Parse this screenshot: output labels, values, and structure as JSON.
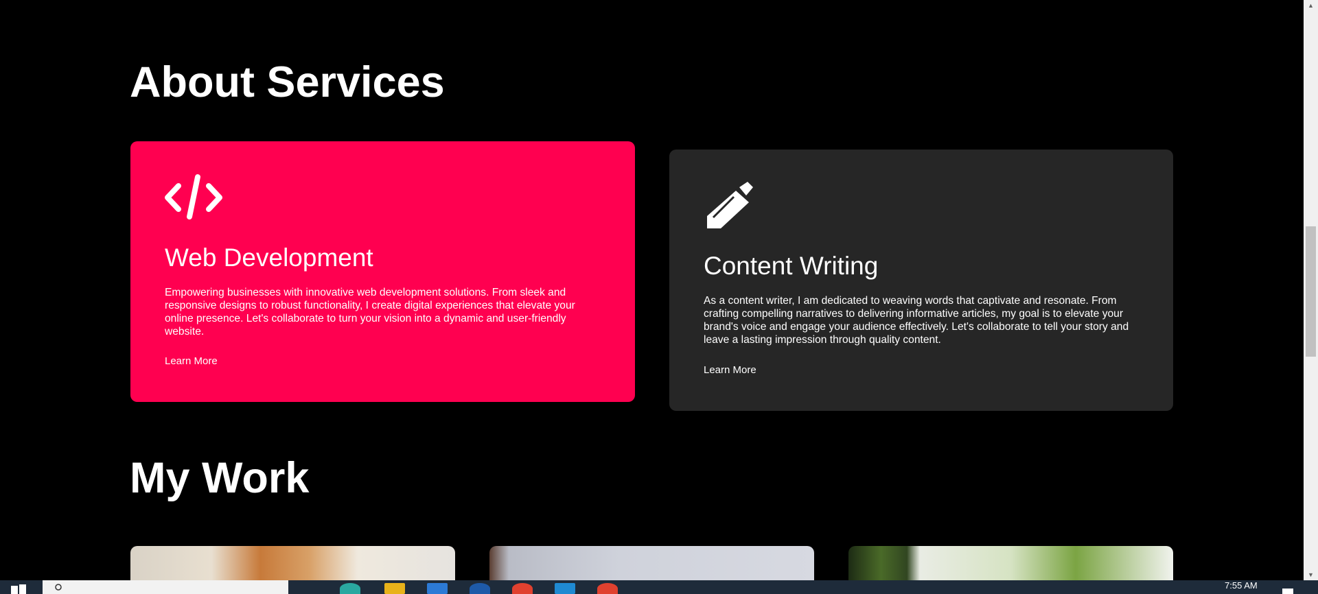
{
  "about_title": "About Services",
  "services": [
    {
      "icon": "code-icon",
      "title": "Web Development",
      "description": "Empowering businesses with innovative web development solutions. From sleek and responsive designs to robust functionality, I create digital experiences that elevate your online presence. Let's collaborate to turn your vision into a dynamic and user-friendly website.",
      "link_label": "Learn More",
      "background": "#ff0050"
    },
    {
      "icon": "pencil-icon",
      "title": "Content Writing",
      "description": "As a content writer, I am dedicated to weaving words that captivate and resonate. From crafting compelling narratives to delivering informative articles, my goal is to elevate your brand's voice and engage your audience effectively. Let's collaborate to tell your story and leave a lasting impression through quality content.",
      "link_label": "Learn More",
      "background": "#262626"
    }
  ],
  "work_title": "My Work",
  "taskbar": {
    "clock": "7:55 AM"
  },
  "colors": {
    "page_background": "#000000",
    "accent": "#ff0050",
    "card_dark": "#262626",
    "taskbar": "#1e2b3a"
  }
}
